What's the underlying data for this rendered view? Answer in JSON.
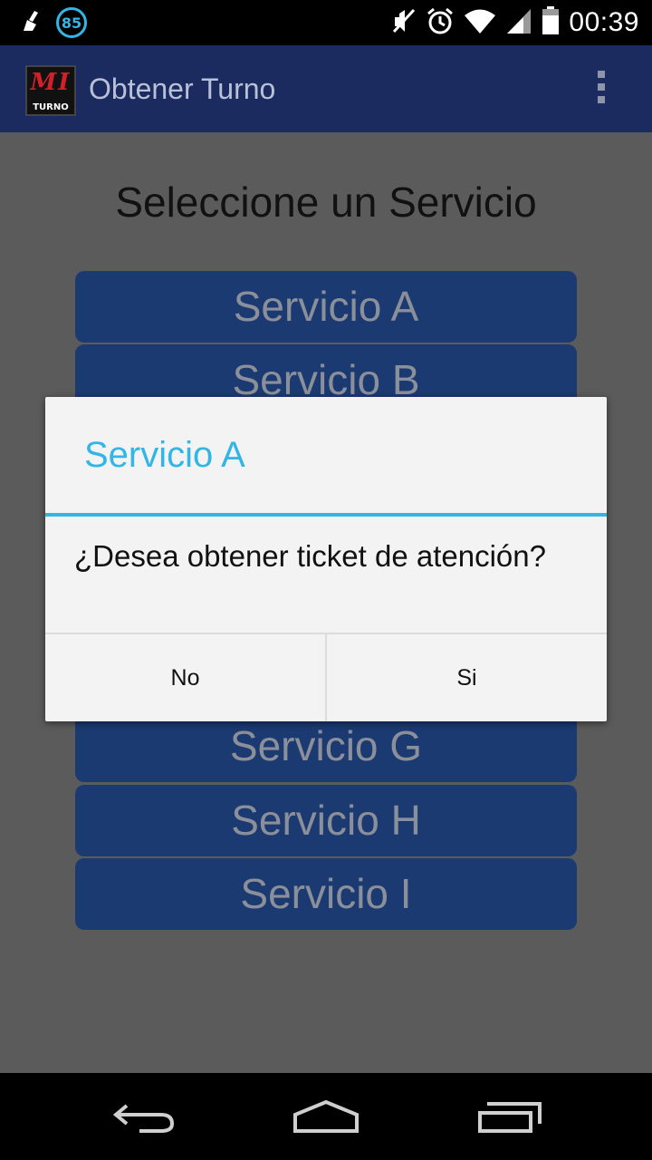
{
  "status_bar": {
    "notification_count": "85",
    "time": "00:39",
    "icons": [
      "broom-icon",
      "mute-icon",
      "alarm-icon",
      "wifi-icon",
      "signal-icon",
      "battery-icon"
    ]
  },
  "action_bar": {
    "logo_top": "MI",
    "logo_bottom": "TURNO",
    "title": "Obtener Turno",
    "overflow_icon": "overflow-menu-icon"
  },
  "main": {
    "heading": "Seleccione un Servicio",
    "services": [
      "Servicio A",
      "Servicio B",
      "Servicio G",
      "Servicio H",
      "Servicio I"
    ]
  },
  "dialog": {
    "title": "Servicio A",
    "message": "¿Desea obtener ticket de atención?",
    "negative": "No",
    "positive": "Si"
  },
  "nav_bar": {
    "icons": [
      "back-icon",
      "home-icon",
      "recents-icon"
    ]
  },
  "colors": {
    "accent": "#33b5e5",
    "action_bar": "#1b2a5f",
    "service_button": "#1b3a72",
    "dim_background": "#5b5b5b"
  }
}
